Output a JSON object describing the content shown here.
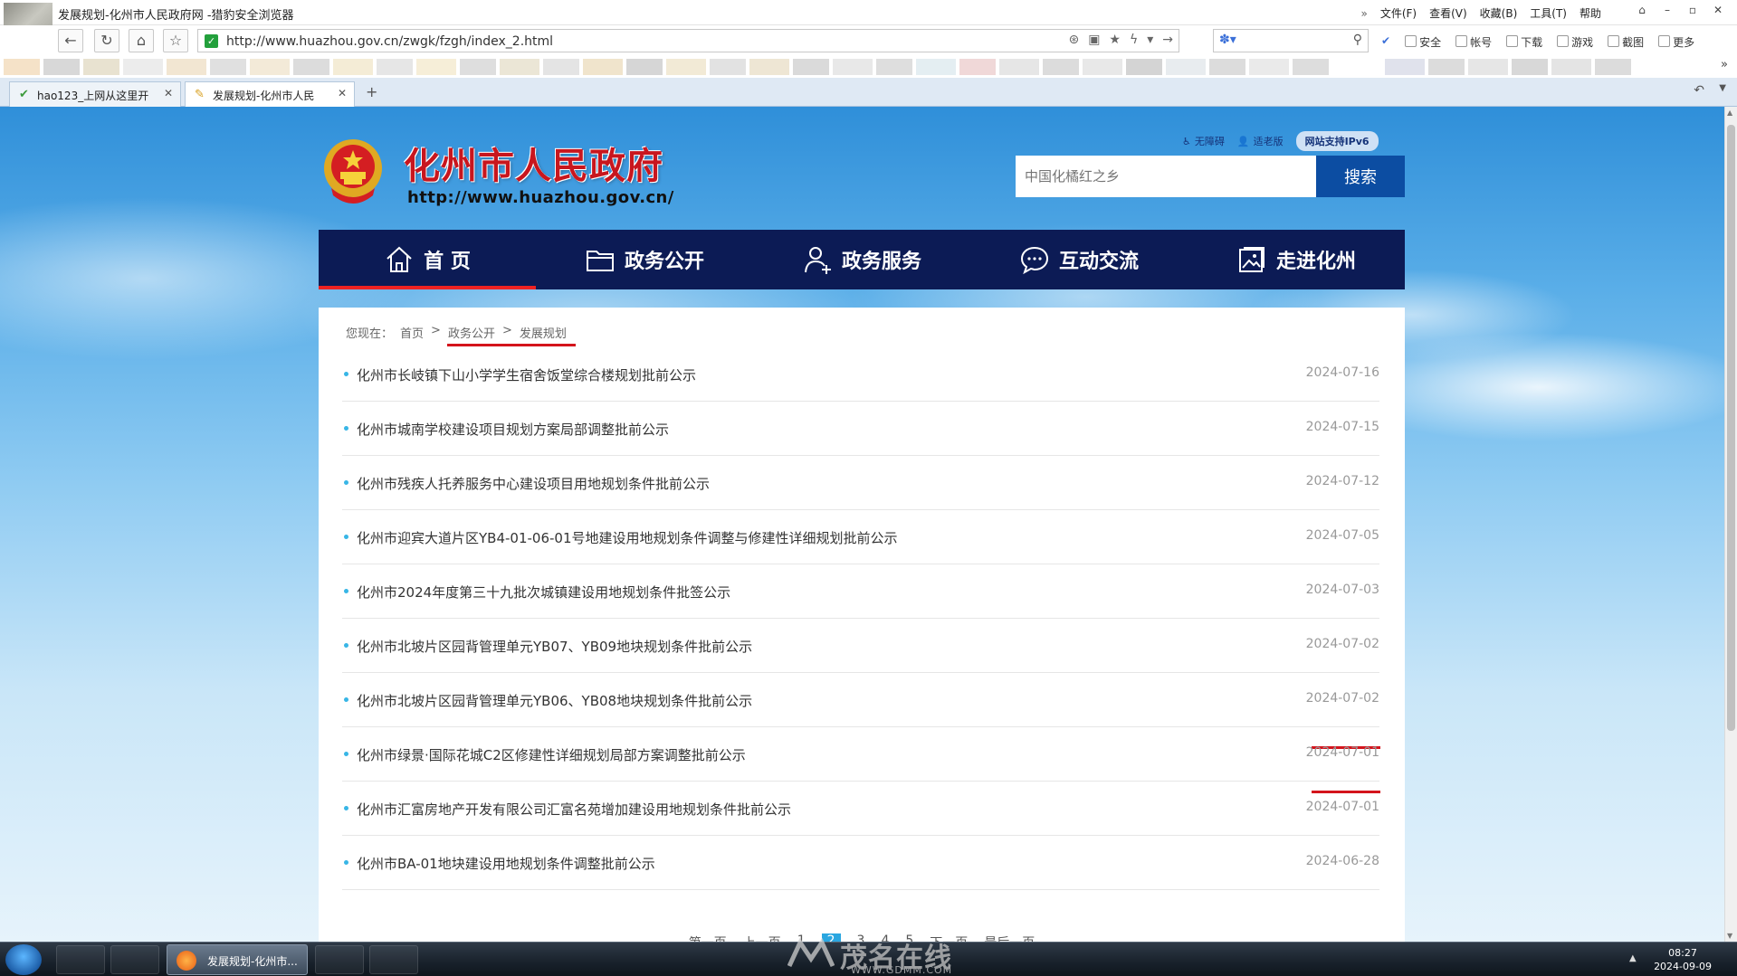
{
  "browser": {
    "window_title": "发展规划-化州市人民政府网 -猎豹安全浏览器",
    "menus": [
      "文件(F)",
      "查看(V)",
      "收藏(B)",
      "工具(T)",
      "帮助"
    ],
    "menu_fold_glyph": "»",
    "url": "http://www.huazhou.gov.cn/zwgk/fzgh/index_2.html",
    "tools": [
      "安全",
      "帐号",
      "下载",
      "游戏",
      "截图",
      "更多"
    ],
    "tabs": [
      {
        "label": "hao123_上网从这里开",
        "active": false
      },
      {
        "label": "发展规划-化州市人民",
        "active": true
      }
    ],
    "new_tab_glyph": "+"
  },
  "site": {
    "name": "化州市人民政府",
    "url_text": "http://www.huazhou.gov.cn/",
    "quick_links": [
      "无障碍",
      "适老版"
    ],
    "ipv6_badge": "网站支持IPv6",
    "search_placeholder": "中国化橘红之乡",
    "search_button": "搜索",
    "nav": [
      {
        "label": "首 页",
        "icon": "home-icon"
      },
      {
        "label": "政务公开",
        "icon": "folder-icon"
      },
      {
        "label": "政务服务",
        "icon": "person-icon"
      },
      {
        "label": "互动交流",
        "icon": "chat-icon"
      },
      {
        "label": "走进化州",
        "icon": "photo-icon"
      }
    ],
    "nav_active_index": 0
  },
  "breadcrumb": {
    "prefix": "您现在：",
    "items": [
      "首页",
      "政务公开",
      "发展规划"
    ],
    "separator": ">"
  },
  "news": [
    {
      "title": "化州市长岐镇下山小学学生宿舍饭堂综合楼规划批前公示",
      "date": "2024-07-16"
    },
    {
      "title": "化州市城南学校建设项目规划方案局部调整批前公示",
      "date": "2024-07-15"
    },
    {
      "title": "化州市残疾人托养服务中心建设项目用地规划条件批前公示",
      "date": "2024-07-12"
    },
    {
      "title": "化州市迎宾大道片区YB4-01-06-01号地建设用地规划条件调整与修建性详细规划批前公示",
      "date": "2024-07-05"
    },
    {
      "title": "化州市2024年度第三十九批次城镇建设用地规划条件批签公示",
      "date": "2024-07-03"
    },
    {
      "title": "化州市北坡片区园背管理单元YB07、YB09地块规划条件批前公示",
      "date": "2024-07-02"
    },
    {
      "title": "化州市北坡片区园背管理单元YB06、YB08地块规划条件批前公示",
      "date": "2024-07-02"
    },
    {
      "title": "化州市绿景·国际花城C2区修建性详细规划局部方案调整批前公示",
      "date": "2024-07-01"
    },
    {
      "title": "化州市汇富房地产开发有限公司汇富名苑增加建设用地规划条件批前公示",
      "date": "2024-07-01"
    },
    {
      "title": "化州市BA-01地块建设用地规划条件调整批前公示",
      "date": "2024-06-28"
    }
  ],
  "pager": {
    "first": "第一页",
    "prev": "上一页",
    "pages": [
      "1",
      "2",
      "3",
      "4",
      "5"
    ],
    "current": "2",
    "next": "下一页",
    "last": "最后一页"
  },
  "watermark": {
    "cn": "茂名在线",
    "en": "WWW.GDMM.COM"
  },
  "taskbar": {
    "active_window": "发展规划-化州市...",
    "time": "08:27",
    "date": "2024-09-09"
  },
  "colors": {
    "nav_bg": "#0c1b55",
    "search_button": "#0c4da2",
    "site_name_red": "#c8161e",
    "annotation_red": "#d4141c",
    "bullet_blue": "#38b6e6"
  }
}
